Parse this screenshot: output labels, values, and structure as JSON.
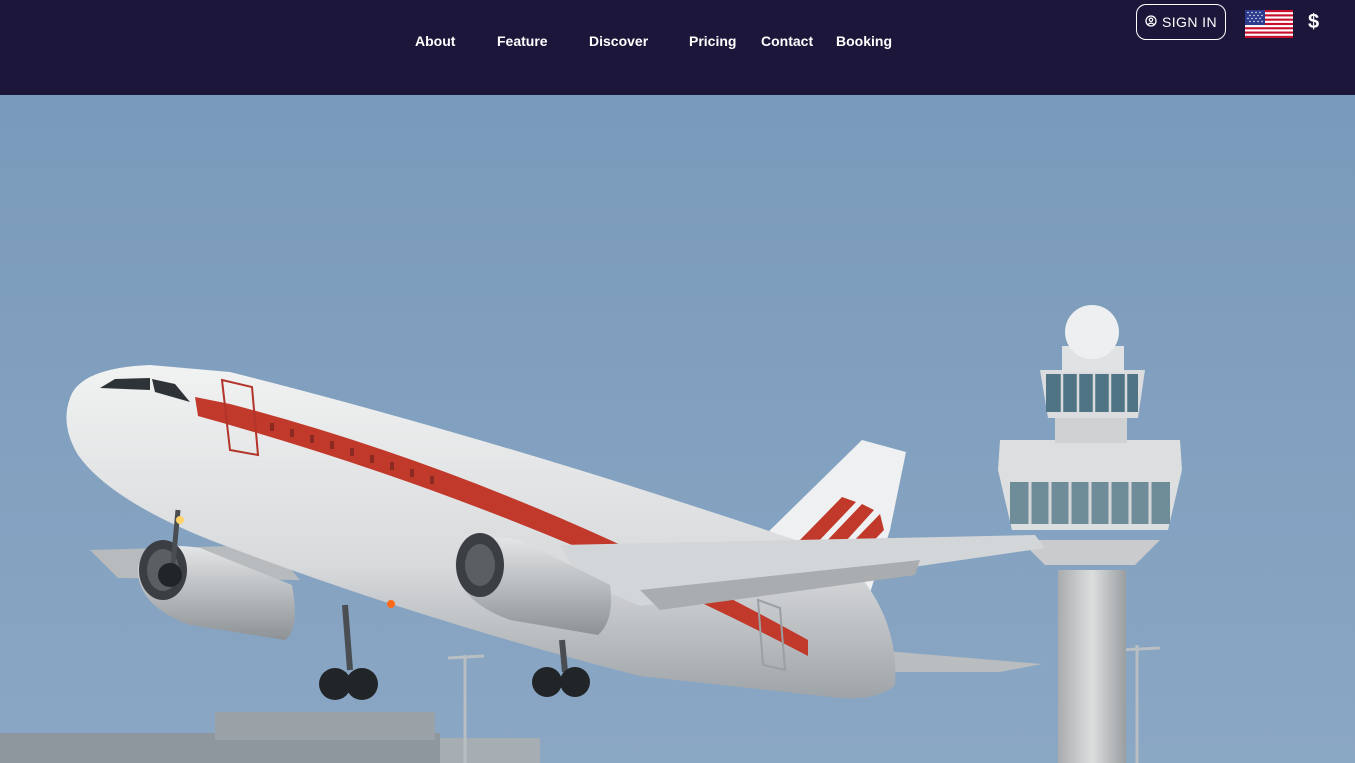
{
  "nav": {
    "links": [
      "About",
      "Feature",
      "Discover",
      "Pricing",
      "Contact",
      "Booking"
    ],
    "signin_label": "SIGN IN",
    "currency_symbol": "$"
  },
  "icons": {
    "signin": "user-circle-icon",
    "language": "us-flag-icon"
  },
  "colors": {
    "navbar_bg": "#1c163a",
    "sky": "#7f9fbe",
    "accent_stripe": "#c0392b"
  }
}
